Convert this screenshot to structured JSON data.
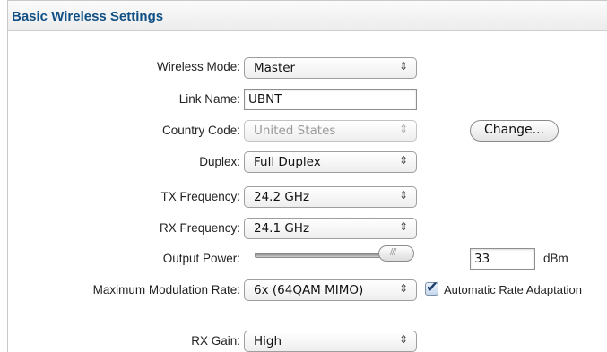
{
  "section": {
    "title": "Basic Wireless Settings"
  },
  "wireless_mode": {
    "label": "Wireless Mode:",
    "value": "Master"
  },
  "link_name": {
    "label": "Link Name:",
    "value": "UBNT"
  },
  "country_code": {
    "label": "Country Code:",
    "value": "United States",
    "change_button": "Change..."
  },
  "duplex": {
    "label": "Duplex:",
    "value": "Full Duplex"
  },
  "tx_frequency": {
    "label": "TX Frequency:",
    "value": "24.2 GHz"
  },
  "rx_frequency": {
    "label": "RX Frequency:",
    "value": "24.1 GHz"
  },
  "output_power": {
    "label": "Output Power:",
    "value": "33",
    "unit": "dBm",
    "slider_level": 1.0
  },
  "modulation": {
    "label": "Maximum Modulation Rate:",
    "value": "6x (64QAM MIMO)",
    "auto_rate_label": "Automatic Rate Adaptation",
    "auto_rate_checked": true
  },
  "rx_gain": {
    "label": "RX Gain:",
    "value": "High"
  },
  "icons": {
    "select_arrows": "up-down-chevron-icon",
    "check": "checkmark-icon"
  },
  "colors": {
    "title": "#0f4f84",
    "checkmark": "#1a3d6b"
  }
}
